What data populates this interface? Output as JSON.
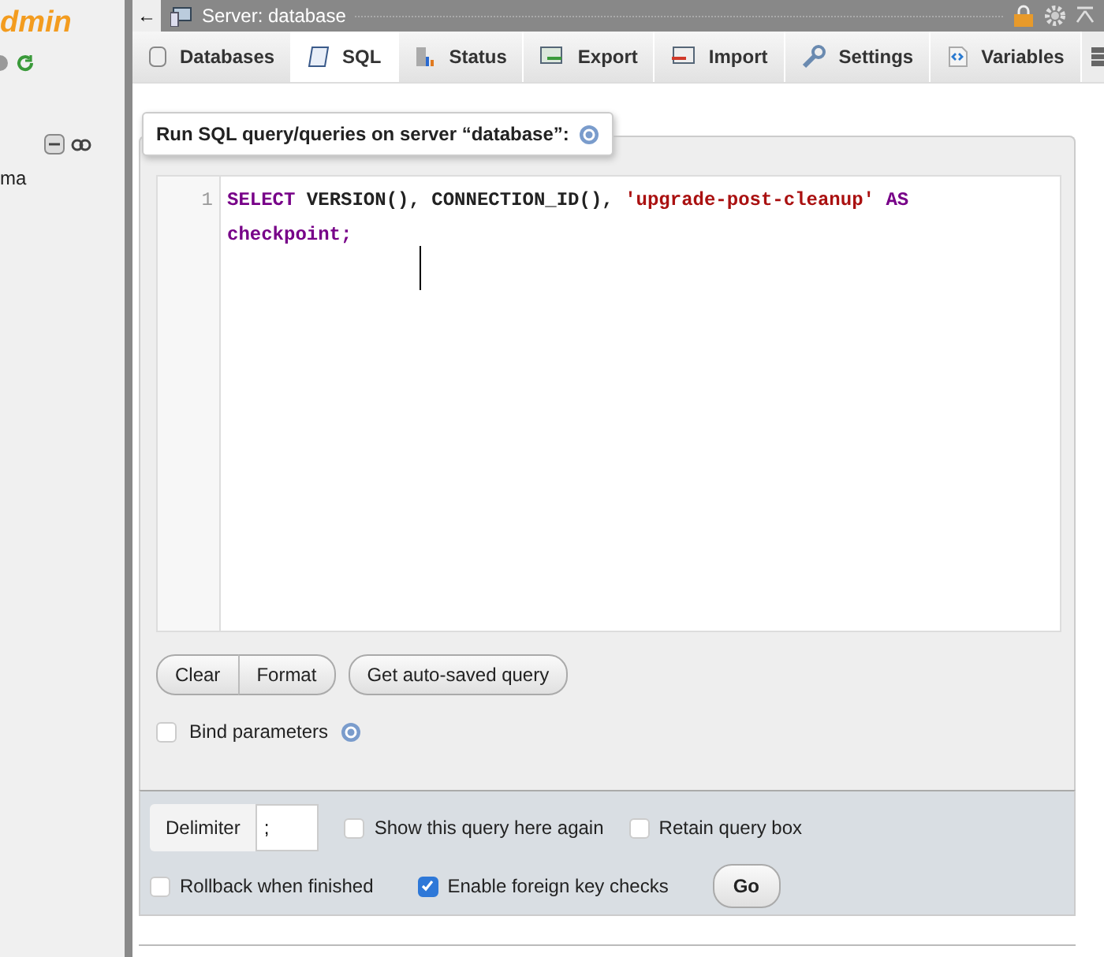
{
  "sidebar": {
    "logo": "dmin",
    "items": [
      {
        "label": "ma"
      }
    ]
  },
  "titlebar": {
    "back": "←",
    "title": "Server: database"
  },
  "tabs": [
    {
      "label": "Databases",
      "selected": false
    },
    {
      "label": "SQL",
      "selected": true
    },
    {
      "label": "Status",
      "selected": false
    },
    {
      "label": "Export",
      "selected": false
    },
    {
      "label": "Import",
      "selected": false
    },
    {
      "label": "Settings",
      "selected": false
    },
    {
      "label": "Variables",
      "selected": false
    }
  ],
  "query_panel": {
    "legend": "Run SQL query/queries on server “database”:",
    "editor": {
      "line_numbers": [
        "1"
      ],
      "lines": [
        [
          {
            "kind": "keyword",
            "text": "SELECT"
          },
          {
            "kind": "plain",
            "text": " VERSION(), CONNECTION_ID(), "
          },
          {
            "kind": "string",
            "text": "'upgrade-post-cleanup'"
          },
          {
            "kind": "keyword",
            "text": " AS"
          }
        ],
        [
          {
            "kind": "keyword",
            "text": "checkpoint;"
          }
        ]
      ]
    },
    "buttons": [
      "Clear",
      "Format",
      "Get auto-saved query"
    ],
    "bind_parameters": {
      "label": "Bind parameters",
      "checked": false
    }
  },
  "options": {
    "delimiter_label": "Delimiter",
    "delimiter_value": ";",
    "checks": [
      {
        "label": "Show this query here again",
        "checked": false
      },
      {
        "label": "Retain query box",
        "checked": false
      },
      {
        "label": "Rollback when finished",
        "checked": false
      },
      {
        "label": "Enable foreign key checks",
        "checked": true
      }
    ],
    "go": "Go"
  }
}
